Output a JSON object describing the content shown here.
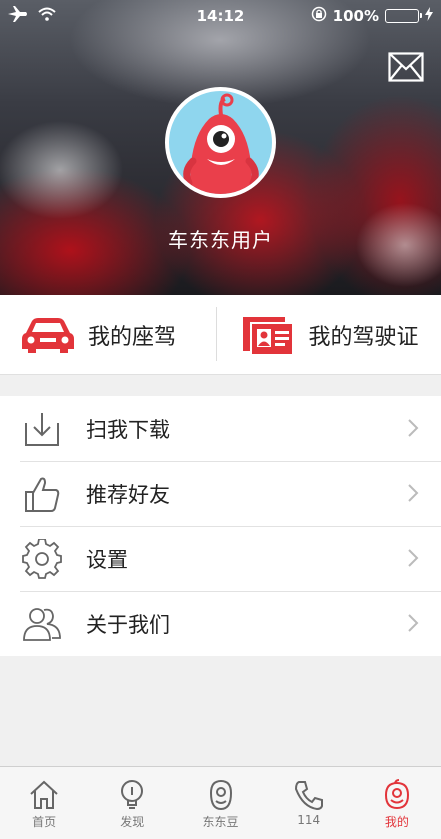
{
  "status_bar": {
    "time": "14:12",
    "battery": "100%",
    "icons": [
      "airplane-icon",
      "wifi-icon",
      "rotation-lock-icon",
      "battery-icon",
      "charging-icon"
    ]
  },
  "profile": {
    "username": "车东东用户",
    "avatar": "red-monster-avatar",
    "mail_icon": "mail-icon"
  },
  "cards": [
    {
      "label": "我的座驾",
      "icon": "car-icon"
    },
    {
      "label": "我的驾驶证",
      "icon": "license-icon"
    }
  ],
  "menu": [
    {
      "label": "扫我下载",
      "icon": "download-icon"
    },
    {
      "label": "推荐好友",
      "icon": "thumbs-up-icon"
    },
    {
      "label": "设置",
      "icon": "gear-icon"
    },
    {
      "label": "关于我们",
      "icon": "people-icon"
    }
  ],
  "tabs": [
    {
      "label": "首页",
      "icon": "home-icon"
    },
    {
      "label": "发现",
      "icon": "lightbulb-icon"
    },
    {
      "label": "东东豆",
      "icon": "bean-icon"
    },
    {
      "label": "114",
      "icon": "phone-icon"
    },
    {
      "label": "我的",
      "icon": "smiley-icon",
      "active": true
    }
  ],
  "colors": {
    "accent": "#e2343a",
    "battery": "#4cd964"
  }
}
